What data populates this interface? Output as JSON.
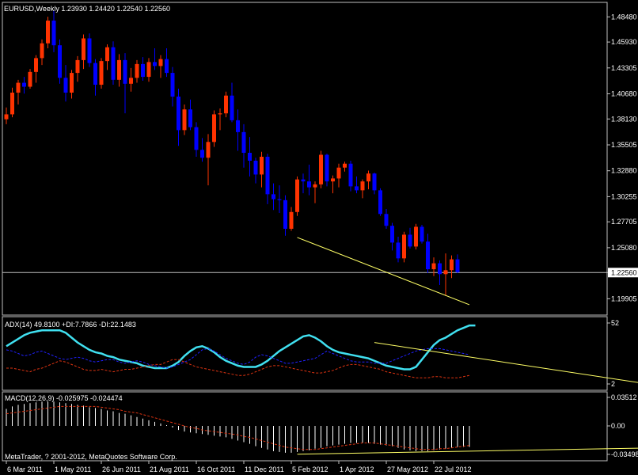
{
  "chart_data": [
    {
      "type": "candlestick",
      "title": "EURUSD,Weekly  1.23930 1.24420 1.22540 1.22560",
      "symbol": "EURUSD",
      "timeframe": "Weekly",
      "last_ohlc": {
        "open": 1.2393,
        "high": 1.2442,
        "low": 1.2254,
        "close": 1.2256
      },
      "current_price_label": "1.22560",
      "ylim": [
        1.1825,
        1.4995
      ],
      "y_ticks": [
        "1.48480",
        "1.45930",
        "1.43305",
        "1.40680",
        "1.38130",
        "1.35505",
        "1.32880",
        "1.30255",
        "1.27705",
        "1.25080",
        "1.22560",
        "1.19905"
      ],
      "x_ticks": [
        "6 Mar 2011",
        "1 May 2011",
        "26 Jun 2011",
        "21 Aug 2011",
        "16 Oct 2011",
        "11 Dec 2011",
        "5 Feb 2012",
        "1 Apr 2012",
        "27 May 2012",
        "22 Jul 2012"
      ],
      "up_color": "#ff3300",
      "down_color": "#0000ff",
      "trendline_color": "#ffff66",
      "candles": [
        [
          1.381,
          1.393,
          1.376,
          1.386
        ],
        [
          1.386,
          1.413,
          1.383,
          1.408
        ],
        [
          1.408,
          1.421,
          1.396,
          1.418
        ],
        [
          1.418,
          1.424,
          1.407,
          1.414
        ],
        [
          1.414,
          1.432,
          1.412,
          1.429
        ],
        [
          1.429,
          1.446,
          1.418,
          1.443
        ],
        [
          1.443,
          1.462,
          1.436,
          1.458
        ],
        [
          1.458,
          1.485,
          1.453,
          1.481
        ],
        [
          1.481,
          1.491,
          1.449,
          1.456
        ],
        [
          1.456,
          1.462,
          1.417,
          1.423
        ],
        [
          1.423,
          1.436,
          1.399,
          1.408
        ],
        [
          1.408,
          1.431,
          1.402,
          1.428
        ],
        [
          1.428,
          1.445,
          1.419,
          1.441
        ],
        [
          1.441,
          1.467,
          1.432,
          1.463
        ],
        [
          1.463,
          1.468,
          1.434,
          1.438
        ],
        [
          1.438,
          1.442,
          1.405,
          1.416
        ],
        [
          1.416,
          1.443,
          1.412,
          1.44
        ],
        [
          1.44,
          1.457,
          1.431,
          1.454
        ],
        [
          1.454,
          1.46,
          1.416,
          1.421
        ],
        [
          1.421,
          1.447,
          1.414,
          1.441
        ],
        [
          1.441,
          1.448,
          1.387,
          1.417
        ],
        [
          1.417,
          1.433,
          1.409,
          1.423
        ],
        [
          1.423,
          1.441,
          1.418,
          1.437
        ],
        [
          1.437,
          1.444,
          1.42,
          1.424
        ],
        [
          1.424,
          1.443,
          1.419,
          1.439
        ],
        [
          1.439,
          1.453,
          1.431,
          1.435
        ],
        [
          1.435,
          1.446,
          1.423,
          1.442
        ],
        [
          1.442,
          1.453,
          1.424,
          1.428
        ],
        [
          1.428,
          1.434,
          1.394,
          1.404
        ],
        [
          1.404,
          1.412,
          1.354,
          1.37
        ],
        [
          1.37,
          1.396,
          1.365,
          1.391
        ],
        [
          1.391,
          1.401,
          1.37,
          1.373
        ],
        [
          1.373,
          1.378,
          1.343,
          1.35
        ],
        [
          1.35,
          1.362,
          1.338,
          1.342
        ],
        [
          1.342,
          1.366,
          1.314,
          1.358
        ],
        [
          1.358,
          1.39,
          1.353,
          1.386
        ],
        [
          1.386,
          1.392,
          1.37,
          1.387
        ],
        [
          1.387,
          1.409,
          1.383,
          1.405
        ],
        [
          1.405,
          1.418,
          1.378,
          1.38
        ],
        [
          1.38,
          1.391,
          1.349,
          1.368
        ],
        [
          1.368,
          1.376,
          1.332,
          1.347
        ],
        [
          1.347,
          1.363,
          1.323,
          1.339
        ],
        [
          1.339,
          1.342,
          1.316,
          1.325
        ],
        [
          1.325,
          1.348,
          1.312,
          1.343
        ],
        [
          1.343,
          1.346,
          1.295,
          1.305
        ],
        [
          1.305,
          1.316,
          1.289,
          1.3
        ],
        [
          1.3,
          1.314,
          1.286,
          1.299
        ],
        [
          1.299,
          1.304,
          1.263,
          1.27
        ],
        [
          1.27,
          1.292,
          1.268,
          1.287
        ],
        [
          1.287,
          1.323,
          1.283,
          1.32
        ],
        [
          1.32,
          1.326,
          1.306,
          1.318
        ],
        [
          1.318,
          1.335,
          1.304,
          1.312
        ],
        [
          1.312,
          1.318,
          1.296,
          1.315
        ],
        [
          1.315,
          1.349,
          1.311,
          1.345
        ],
        [
          1.345,
          1.346,
          1.313,
          1.318
        ],
        [
          1.318,
          1.324,
          1.306,
          1.321
        ],
        [
          1.321,
          1.336,
          1.312,
          1.332
        ],
        [
          1.332,
          1.338,
          1.328,
          1.336
        ],
        [
          1.336,
          1.339,
          1.308,
          1.313
        ],
        [
          1.313,
          1.323,
          1.306,
          1.309
        ],
        [
          1.309,
          1.32,
          1.301,
          1.318
        ],
        [
          1.318,
          1.329,
          1.31,
          1.326
        ],
        [
          1.326,
          1.327,
          1.305,
          1.309
        ],
        [
          1.309,
          1.311,
          1.283,
          1.285
        ],
        [
          1.285,
          1.29,
          1.27,
          1.273
        ],
        [
          1.273,
          1.276,
          1.248,
          1.256
        ],
        [
          1.256,
          1.262,
          1.236,
          1.24
        ],
        [
          1.24,
          1.267,
          1.236,
          1.264
        ],
        [
          1.264,
          1.271,
          1.25,
          1.252
        ],
        [
          1.252,
          1.275,
          1.249,
          1.272
        ],
        [
          1.272,
          1.274,
          1.255,
          1.257
        ],
        [
          1.257,
          1.265,
          1.225,
          1.229
        ],
        [
          1.229,
          1.241,
          1.222,
          1.235
        ],
        [
          1.235,
          1.238,
          1.213,
          1.224
        ],
        [
          1.224,
          1.245,
          1.202,
          1.228
        ],
        [
          1.228,
          1.243,
          1.22,
          1.239
        ],
        [
          1.239,
          1.244,
          1.225,
          1.226
        ]
      ],
      "trendlines": [
        {
          "from": [
            49,
            1.2612
          ],
          "to": [
            78,
            1.193
          ]
        }
      ]
    },
    {
      "type": "line",
      "title": "ADX(14) 49.8100 +DI:7.7866 -DI:22.1483",
      "y_ticks": [
        "52",
        "2"
      ],
      "ylim": [
        2,
        52
      ],
      "series": [
        {
          "name": "ADX(14)",
          "color": "#40e0f0",
          "values": [
            33,
            36,
            39,
            42,
            44,
            45,
            46,
            46,
            46,
            46,
            44,
            40,
            36,
            33,
            30,
            28,
            27,
            25,
            24,
            22,
            21,
            20,
            19,
            17,
            16,
            15,
            15,
            15,
            17,
            20,
            25,
            29,
            32,
            33,
            31,
            28,
            24,
            21,
            19,
            17,
            16,
            16,
            16,
            18,
            21,
            25,
            29,
            32,
            35,
            38,
            41,
            42,
            40,
            37,
            33,
            30,
            28,
            27,
            26,
            25,
            24,
            23,
            21,
            19,
            17,
            16,
            15,
            14,
            14,
            16,
            22,
            28,
            34,
            38,
            40,
            43,
            46,
            48,
            50,
            50
          ]
        },
        {
          "name": "+DI",
          "color": "#2020ff",
          "values": [
            30,
            29,
            27,
            25,
            26,
            28,
            29,
            27,
            25,
            23,
            22,
            23,
            24,
            23,
            21,
            20,
            21,
            22,
            22,
            20,
            19,
            20,
            21,
            20,
            18,
            17,
            16,
            15,
            16,
            18,
            20,
            22,
            26,
            30,
            31,
            29,
            26,
            23,
            21,
            19,
            18,
            20,
            24,
            26,
            25,
            23,
            21,
            19,
            19,
            20,
            21,
            22,
            23,
            26,
            29,
            27,
            25,
            23,
            21,
            20,
            20,
            20,
            19,
            19,
            19,
            21,
            23,
            25,
            27,
            29,
            30,
            31,
            31,
            31,
            30,
            29,
            28,
            27,
            26
          ]
        },
        {
          "name": "-DI",
          "color": "#dd3311",
          "values": [
            15,
            15,
            14,
            13,
            12,
            14,
            15,
            17,
            19,
            21,
            20,
            18,
            16,
            14,
            13,
            13,
            14,
            13,
            12,
            13,
            14,
            14,
            15,
            16,
            17,
            18,
            18,
            20,
            22,
            22,
            20,
            18,
            16,
            15,
            14,
            13,
            12,
            11,
            10,
            9,
            9,
            10,
            12,
            14,
            16,
            17,
            17,
            16,
            15,
            14,
            13,
            12,
            11,
            11,
            12,
            13,
            15,
            17,
            18,
            18,
            17,
            16,
            15,
            14,
            12,
            11,
            10,
            9,
            8,
            7,
            7,
            7,
            8,
            8,
            7,
            7,
            7,
            8,
            9
          ]
        }
      ],
      "trendlines": [
        {
          "from": [
            62,
            36
          ],
          "to": [
            108,
            2
          ]
        }
      ]
    },
    {
      "type": "bar",
      "title": "MACD(12,26,9) -0.025975 -0.024474",
      "y_ticks": [
        "0.03512",
        "0.00",
        "-0.03498"
      ],
      "ylim": [
        -0.038,
        0.038
      ],
      "series": [
        {
          "name": "MACD",
          "color": "#ffffff",
          "values": [
            0.021,
            0.024,
            0.026,
            0.027,
            0.028,
            0.029,
            0.03,
            0.03,
            0.03,
            0.029,
            0.028,
            0.027,
            0.026,
            0.025,
            0.023,
            0.022,
            0.021,
            0.019,
            0.018,
            0.016,
            0.015,
            0.013,
            0.011,
            0.009,
            0.007,
            0.005,
            0.003,
            0.001,
            -0.002,
            -0.005,
            -0.007,
            -0.008,
            -0.009,
            -0.01,
            -0.011,
            -0.012,
            -0.013,
            -0.014,
            -0.016,
            -0.018,
            -0.02,
            -0.022,
            -0.025,
            -0.027,
            -0.029,
            -0.031,
            -0.032,
            -0.033,
            -0.033,
            -0.032,
            -0.031,
            -0.03,
            -0.028,
            -0.027,
            -0.025,
            -0.024,
            -0.023,
            -0.022,
            -0.021,
            -0.021,
            -0.021,
            -0.021,
            -0.022,
            -0.023,
            -0.024,
            -0.025,
            -0.027,
            -0.029,
            -0.03,
            -0.031,
            -0.031,
            -0.031,
            -0.03,
            -0.029,
            -0.028,
            -0.027,
            -0.026,
            -0.026,
            -0.026
          ]
        },
        {
          "name": "Signal",
          "color": "#dd3311",
          "values": [
            0.015,
            0.016,
            0.017,
            0.018,
            0.019,
            0.02,
            0.021,
            0.022,
            0.023,
            0.024,
            0.024,
            0.024,
            0.024,
            0.024,
            0.024,
            0.024,
            0.023,
            0.022,
            0.021,
            0.02,
            0.018,
            0.017,
            0.016,
            0.014,
            0.012,
            0.01,
            0.008,
            0.006,
            0.004,
            0.002,
            0.0,
            -0.002,
            -0.003,
            -0.005,
            -0.006,
            -0.007,
            -0.008,
            -0.009,
            -0.01,
            -0.011,
            -0.013,
            -0.014,
            -0.016,
            -0.018,
            -0.02,
            -0.022,
            -0.024,
            -0.026,
            -0.027,
            -0.028,
            -0.029,
            -0.029,
            -0.029,
            -0.028,
            -0.027,
            -0.026,
            -0.025,
            -0.024,
            -0.023,
            -0.022,
            -0.021,
            -0.021,
            -0.021,
            -0.022,
            -0.023,
            -0.024,
            -0.025,
            -0.026,
            -0.027,
            -0.028,
            -0.029,
            -0.029,
            -0.029,
            -0.028,
            -0.028,
            -0.027,
            -0.026,
            -0.025,
            -0.024
          ]
        }
      ],
      "trendlines": [
        {
          "from": [
            49,
            -0.0348
          ],
          "to": [
            108,
            -0.0272
          ]
        }
      ]
    }
  ],
  "footer_text": "MetaTrader, ? 2001-2012, MetaQuotes Software Corp.",
  "colors": {
    "background": "#000000",
    "axis": "#c0c0c0",
    "text": "#ffffff"
  }
}
